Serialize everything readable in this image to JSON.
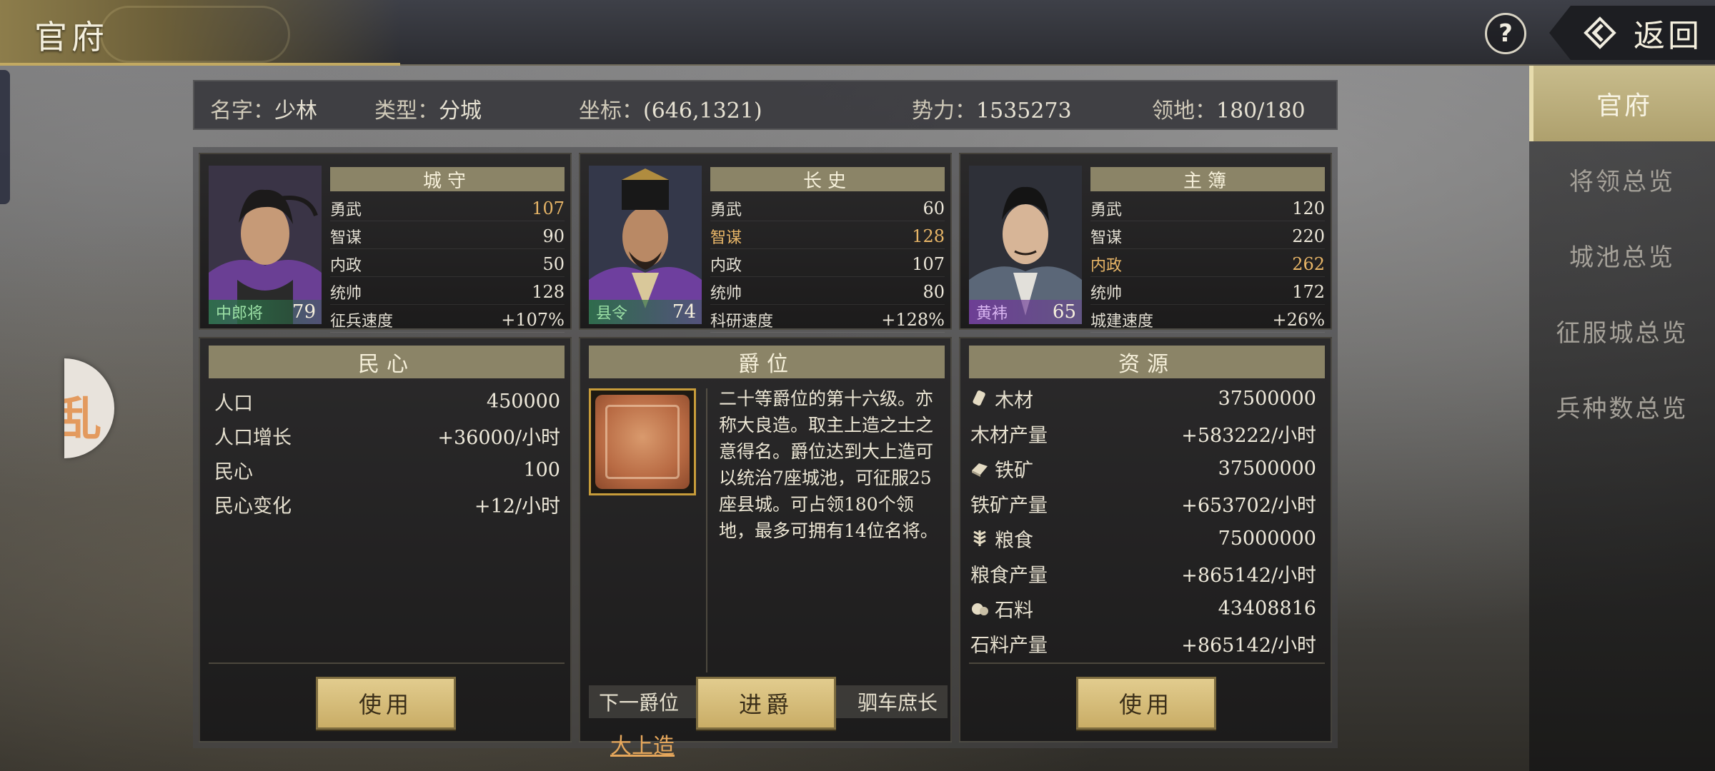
{
  "header": {
    "title": "官府",
    "help_label": "?",
    "back_label": "返回"
  },
  "side_badge": "乱",
  "sidebar": {
    "items": [
      {
        "label": "官府",
        "active": true
      },
      {
        "label": "将领总览",
        "active": false
      },
      {
        "label": "城池总览",
        "active": false
      },
      {
        "label": "征服城总览",
        "active": false
      },
      {
        "label": "兵种数总览",
        "active": false
      }
    ]
  },
  "info": {
    "name_label": "名字：",
    "name": "少林",
    "type_label": "类型：",
    "type": "分城",
    "coord_label": "坐标：",
    "coord": "(646,1321)",
    "power_label": "势力：",
    "power": "1535273",
    "land_label": "领地：",
    "land": "180/180"
  },
  "officers": [
    {
      "role": "城守",
      "rank": "中郎将",
      "level": "79",
      "stats": [
        {
          "k": "勇武",
          "v": "107",
          "hl": true
        },
        {
          "k": "智谋",
          "v": "90",
          "hl": false
        },
        {
          "k": "内政",
          "v": "50",
          "hl": false
        },
        {
          "k": "统帅",
          "v": "128",
          "hl": false
        },
        {
          "k": "征兵速度",
          "v": "+107%",
          "hl": false
        }
      ]
    },
    {
      "role": "长史",
      "rank": "县令",
      "level": "74",
      "stats": [
        {
          "k": "勇武",
          "v": "60",
          "hl": false
        },
        {
          "k": "智谋",
          "v": "128",
          "hl": true
        },
        {
          "k": "内政",
          "v": "107",
          "hl": false
        },
        {
          "k": "统帅",
          "v": "80",
          "hl": false
        },
        {
          "k": "科研速度",
          "v": "+128%",
          "hl": false
        }
      ]
    },
    {
      "role": "主簿",
      "rank": "黄袆",
      "level": "65",
      "stats": [
        {
          "k": "勇武",
          "v": "120",
          "hl": false
        },
        {
          "k": "智谋",
          "v": "220",
          "hl": false
        },
        {
          "k": "内政",
          "v": "262",
          "hl": true
        },
        {
          "k": "统帅",
          "v": "172",
          "hl": false
        },
        {
          "k": "城建速度",
          "v": "+26%",
          "hl": false
        }
      ]
    }
  ],
  "morale": {
    "title": "民心",
    "rows": [
      {
        "k": "人口",
        "v": "450000"
      },
      {
        "k": "人口增长",
        "v": "+36000/小时"
      },
      {
        "k": "民心",
        "v": "100"
      },
      {
        "k": "民心变化",
        "v": "+12/小时"
      }
    ],
    "button": "使用"
  },
  "nobility": {
    "title": "爵位",
    "rank_name": "大上造",
    "description": "二十等爵位的第十六级。亦称大良造。取主上造之士之意得名。爵位达到大上造可以统治7座城池，可征服25座县城。可占领180个领地，最多可拥有14位名将。",
    "next_label": "下一爵位",
    "next_rank": "驷车庶长",
    "button": "进爵"
  },
  "resources": {
    "title": "资源",
    "rows": [
      {
        "k": "木材",
        "v": "37500000",
        "icon": "wood-icon"
      },
      {
        "k": "木材产量",
        "v": "+583222/小时",
        "icon": ""
      },
      {
        "k": "铁矿",
        "v": "37500000",
        "icon": "iron-icon"
      },
      {
        "k": "铁矿产量",
        "v": "+653702/小时",
        "icon": ""
      },
      {
        "k": "粮食",
        "v": "75000000",
        "icon": "grain-icon"
      },
      {
        "k": "粮食产量",
        "v": "+865142/小时",
        "icon": ""
      },
      {
        "k": "石料",
        "v": "43408816",
        "icon": "stone-icon"
      },
      {
        "k": "石料产量",
        "v": "+865142/小时",
        "icon": ""
      }
    ],
    "button": "使用"
  }
}
